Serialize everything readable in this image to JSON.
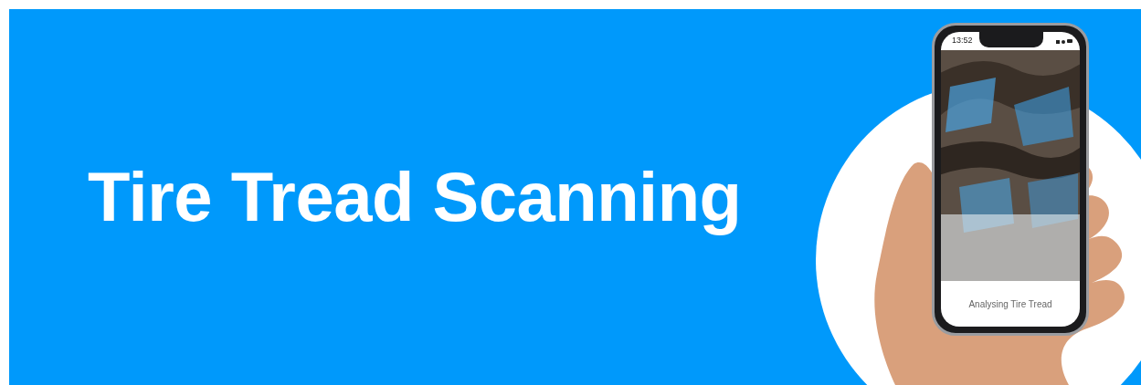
{
  "banner": {
    "title": "Tire Tread Scanning"
  },
  "phone": {
    "status_time": "13:52",
    "caption": "Analysing Tire Tread"
  }
}
